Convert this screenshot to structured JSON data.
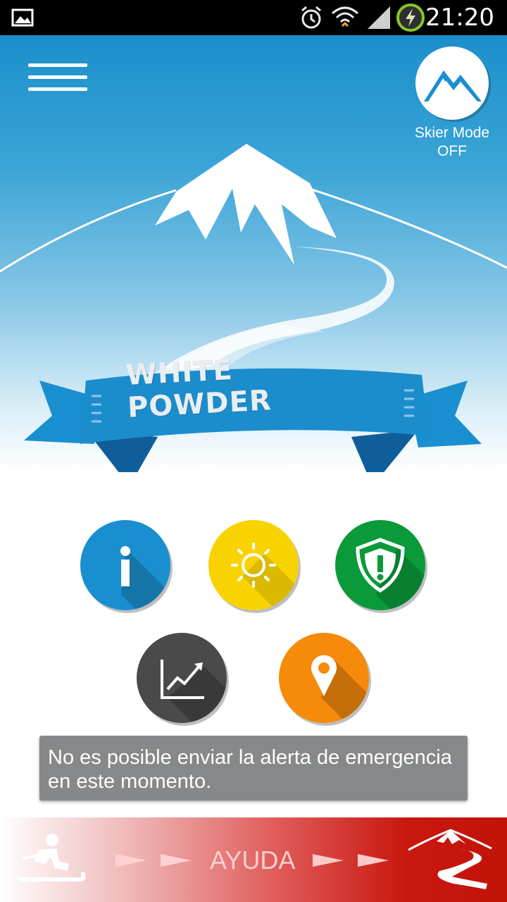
{
  "status_bar": {
    "time": "21:20",
    "icons": [
      "image-icon",
      "alarm-icon",
      "wifi-icon",
      "signal-icon",
      "battery-charging-icon"
    ]
  },
  "header": {
    "menu_icon": "hamburger-menu-icon",
    "skier_mode": {
      "line1": "Skier Mode",
      "line2": "OFF"
    }
  },
  "banner": {
    "title": "WHITE POWDER"
  },
  "actions": [
    {
      "name": "info",
      "icon": "info-icon",
      "color": "#1a8fcf"
    },
    {
      "name": "weather",
      "icon": "sun-icon",
      "color": "#f9d300"
    },
    {
      "name": "alert",
      "icon": "shield-alert-icon",
      "color": "#0a9a3a"
    },
    {
      "name": "stats",
      "icon": "chart-trend-icon",
      "color": "#4a4a4a"
    },
    {
      "name": "location",
      "icon": "map-pin-icon",
      "color": "#f68a0b"
    }
  ],
  "toast": {
    "message": "No es posible enviar la alerta de emergencia en este momento."
  },
  "help_bar": {
    "label": "AYUDA",
    "left_icon": "fallen-skier-icon",
    "right_icon": "mountain-trail-icon",
    "color": "#c21309"
  }
}
